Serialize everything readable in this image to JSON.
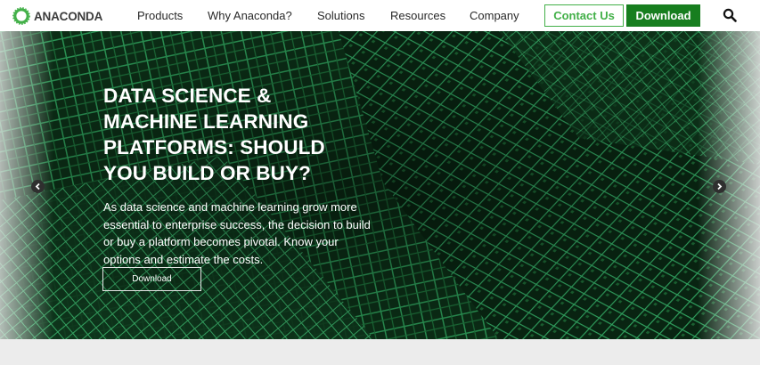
{
  "brand": {
    "name": "ANACONDA",
    "logo_color": "#43b049"
  },
  "nav": {
    "items": [
      {
        "label": "Products"
      },
      {
        "label": "Why Anaconda?"
      },
      {
        "label": "Solutions"
      },
      {
        "label": "Resources"
      },
      {
        "label": "Company"
      }
    ],
    "contact_label": "Contact Us",
    "download_label": "Download",
    "search_icon": "search-icon"
  },
  "hero": {
    "title_lines": [
      "DATA SCIENCE &",
      "MACHINE LEARNING",
      "PLATFORMS: SHOULD",
      "YOU BUILD OR BUY?"
    ],
    "text": "As data science and machine learning grow more essential to enterprise success, the decision to build or buy a platform becomes pivotal. Know your options and estimate the costs.",
    "button_label": "Download",
    "prev_icon": "chevron-left-icon",
    "next_icon": "chevron-right-icon"
  },
  "colors": {
    "accent": "#43b049",
    "download": "#177e1f",
    "hero_green": "#1f8a4a"
  }
}
